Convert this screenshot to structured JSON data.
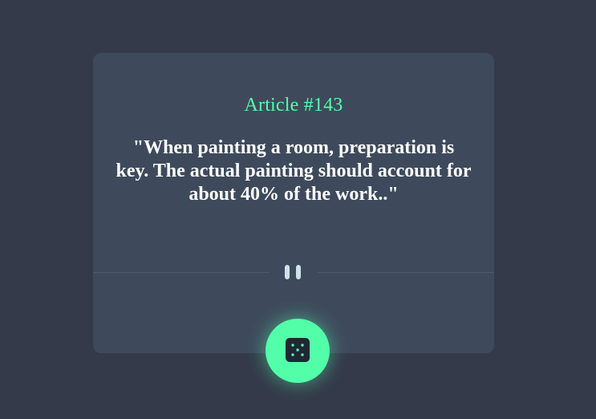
{
  "advice": {
    "id_label": "Article #143",
    "text": "\"When painting a room, preparation is key. The actual painting should account for about 40% of the work..\""
  },
  "icons": {
    "divider": "pause-icon",
    "button": "dice-icon"
  },
  "colors": {
    "background": "#343a4a",
    "card": "#3e4a5c",
    "accent": "#52ffa8",
    "text": "#ffffff",
    "divider": "#4f5b6c",
    "divider_icon": "#cee3e9",
    "dice_face": "#202733"
  }
}
